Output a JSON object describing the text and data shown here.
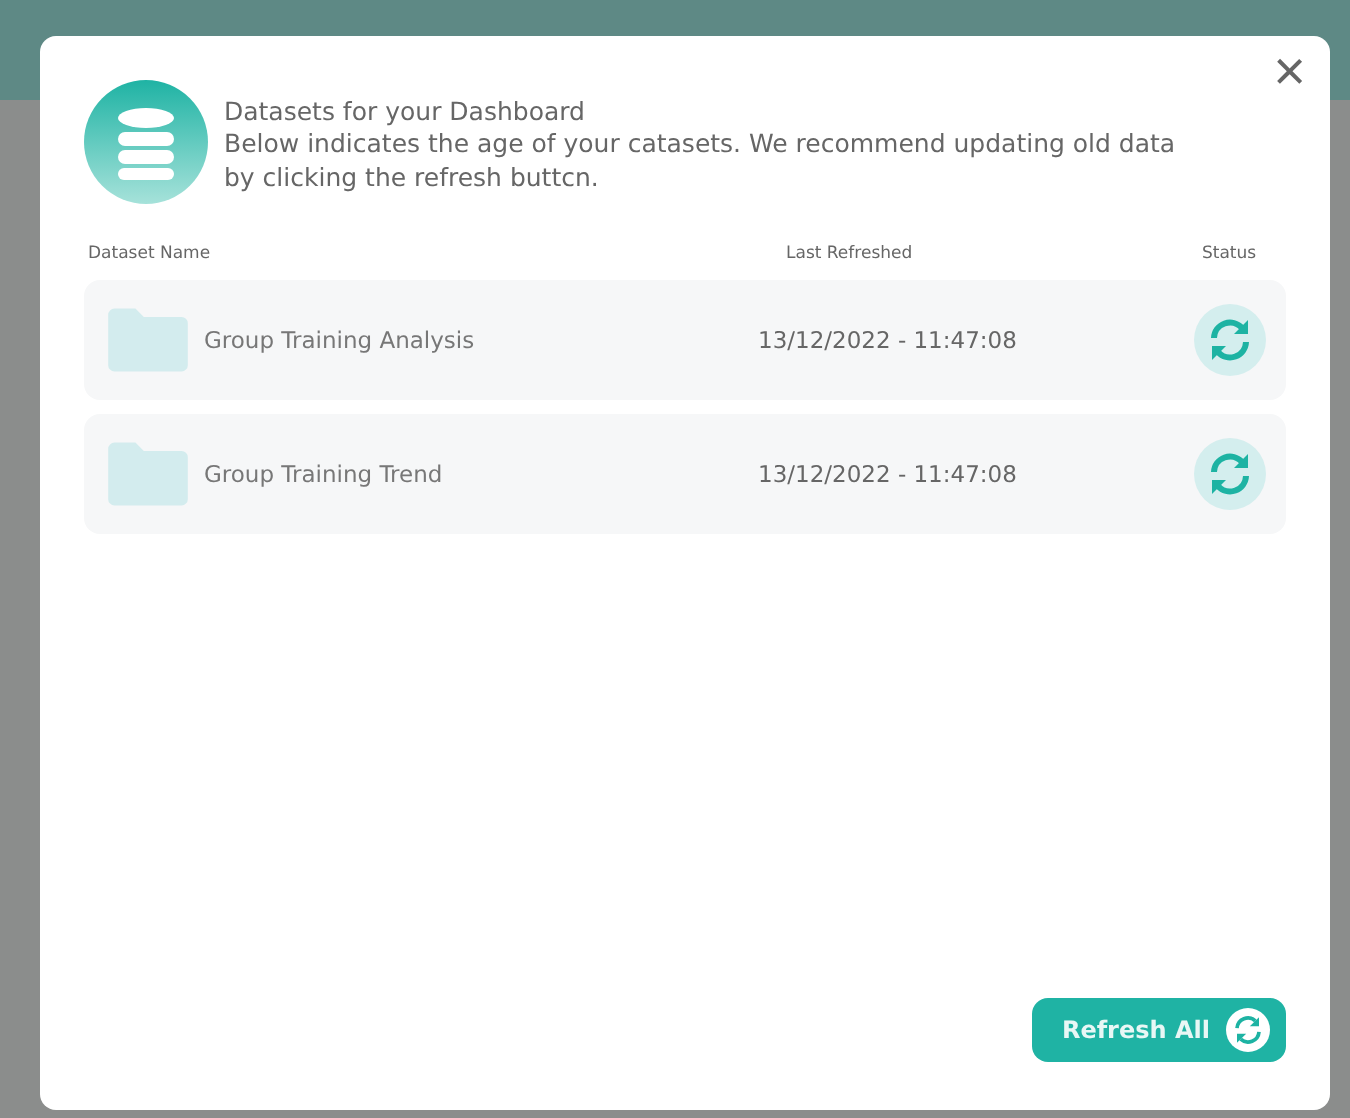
{
  "dialog": {
    "close": "×",
    "title": "Datasets for your Dashboard",
    "description": "Below indicates the age of your catasets. We recommend updating old data by clicking the refresh buttcn."
  },
  "table": {
    "columns": [
      "Dataset Name",
      "Last Refreshed",
      "Status"
    ],
    "rows": [
      {
        "name": "Group Training Analysis",
        "refreshed": "13/12/2022 - 11:47:08"
      },
      {
        "name": "Group Training Trend",
        "refreshed": "13/12/2022 - 11:47:08"
      }
    ]
  },
  "buttons": [
    {
      "label": "Refresh All"
    }
  ]
}
